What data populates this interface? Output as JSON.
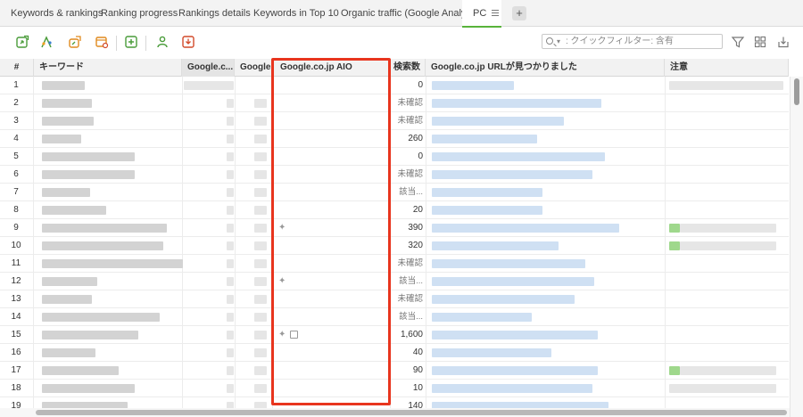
{
  "tabs": [
    {
      "label": "Keywords & rankings"
    },
    {
      "label": "Ranking progress"
    },
    {
      "label": "Rankings details"
    },
    {
      "label": "Keywords in Top 10"
    },
    {
      "label": "Organic traffic (Google Analytics)"
    },
    {
      "label": "PC",
      "active": true
    }
  ],
  "add_tab_label": "+",
  "toolbar": {
    "icons": [
      "refresh-ranks-icon",
      "keyword-research-icon",
      "update-icon",
      "schedule-icon",
      "add-keyword-icon",
      "competitors-icon",
      "export-icon"
    ],
    "filter_placeholder": ": クイックフィルター: 含有",
    "right_icons": [
      "filter-icon",
      "columns-icon",
      "download-icon"
    ]
  },
  "columns": {
    "index": "#",
    "keyword": "キーワード",
    "google_rank": "Google.c...",
    "google_prev": "Google...",
    "aio": "Google.co.jp AIO",
    "volume": "検索数",
    "url_found": "Google.co.jp URLが見つかりました",
    "notes": "注意"
  },
  "rows": [
    {
      "n": "1",
      "volume": "0"
    },
    {
      "n": "2",
      "volume": "未確認"
    },
    {
      "n": "3",
      "volume": "未確認"
    },
    {
      "n": "4",
      "volume": "260"
    },
    {
      "n": "5",
      "volume": "0"
    },
    {
      "n": "6",
      "volume": "未確認"
    },
    {
      "n": "7",
      "volume": "該当..."
    },
    {
      "n": "8",
      "volume": "20"
    },
    {
      "n": "9",
      "volume": "390",
      "aio_icon": "✦"
    },
    {
      "n": "10",
      "volume": "320"
    },
    {
      "n": "11",
      "volume": "未確認"
    },
    {
      "n": "12",
      "volume": "該当...",
      "aio_icon": "✦"
    },
    {
      "n": "13",
      "volume": "未確認"
    },
    {
      "n": "14",
      "volume": "該当..."
    },
    {
      "n": "15",
      "volume": "1,600",
      "aio_icon": "✦"
    },
    {
      "n": "16",
      "volume": "40"
    },
    {
      "n": "17",
      "volume": "90"
    },
    {
      "n": "18",
      "volume": "10"
    },
    {
      "n": "19",
      "volume": "140"
    }
  ],
  "colors": {
    "highlight": "#e8351e",
    "active_tab_accent": "#58b33b",
    "note_green": "#9fd88c",
    "url_blur": "#cfe0f3"
  }
}
